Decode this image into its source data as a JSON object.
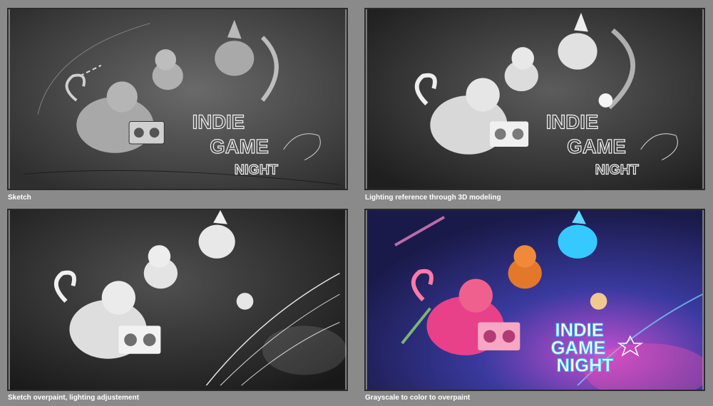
{
  "panels": [
    {
      "caption": "Sketch",
      "title_lines": [
        "INDIE",
        "GAME",
        "NIGHT"
      ]
    },
    {
      "caption": "Lighting reference through 3D modeling",
      "title_lines": [
        "INDIE",
        "GAME",
        "NIGHT"
      ]
    },
    {
      "caption": "Sketch overpaint, lighting adjustement",
      "title_lines": []
    },
    {
      "caption": "Grayscale to color to overpaint",
      "title_lines": [
        "INDIE",
        "GAME",
        "NIGHT"
      ]
    }
  ],
  "colors": {
    "page_background": "#8a8a8a",
    "caption_text": "#ffffff",
    "night_sky": "#2a2c7a",
    "neon_pink": "#e8418a",
    "neon_cyan": "#35c9ff"
  }
}
